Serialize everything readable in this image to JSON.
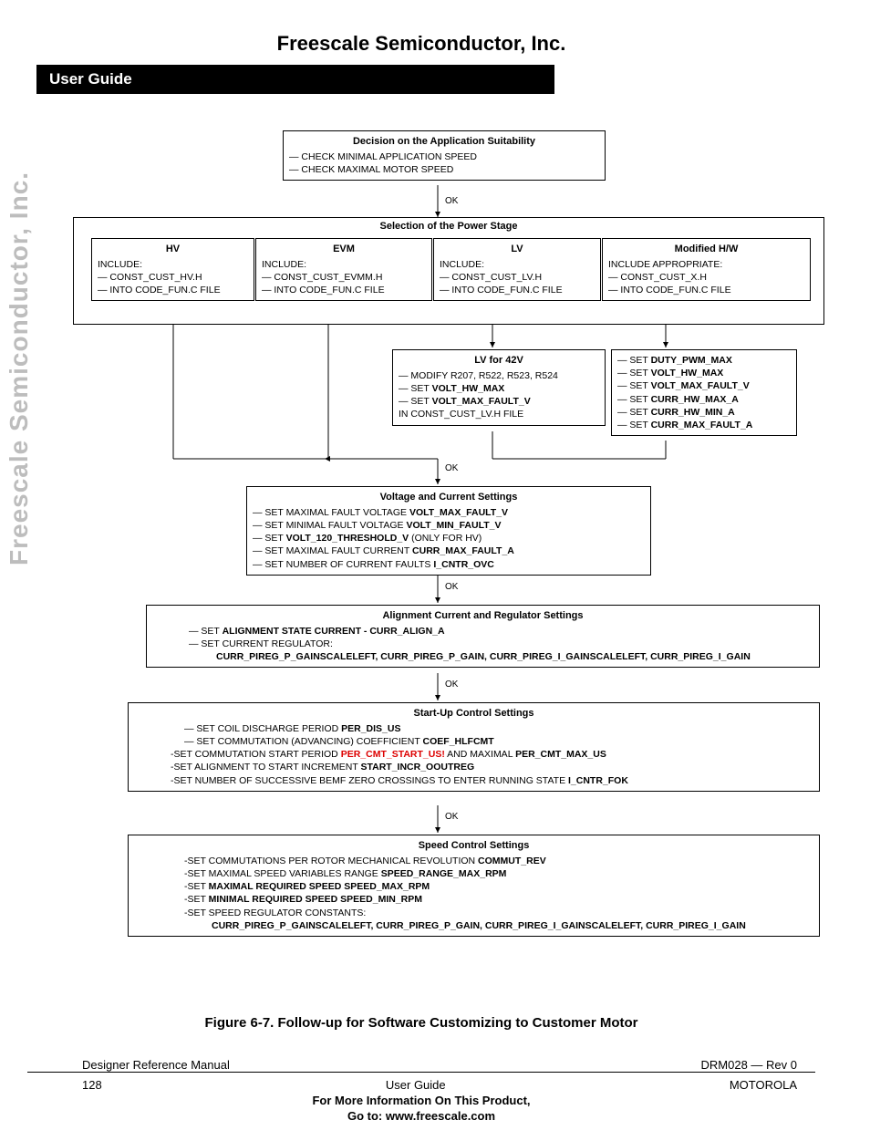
{
  "company": "Freescale Semiconductor, Inc.",
  "header_bar": "User Guide",
  "side_text": "Freescale Semiconductor, Inc.",
  "ok": "OK",
  "decision": {
    "title": "Decision on the Application Suitability",
    "l1": "— CHECK MINIMAL APPLICATION SPEED",
    "l2": "— CHECK MAXIMAL MOTOR SPEED"
  },
  "selection_title": "Selection of the Power Stage",
  "hv": {
    "title": "HV",
    "inc": "INCLUDE:",
    "l1": "— CONST_CUST_HV.H",
    "l2": "— INTO CODE_FUN.C FILE"
  },
  "evm": {
    "title": "EVM",
    "inc": "INCLUDE:",
    "l1": "— CONST_CUST_EVMM.H",
    "l2": "— INTO CODE_FUN.C FILE"
  },
  "lv": {
    "title": "LV",
    "inc": "INCLUDE:",
    "l1": "— CONST_CUST_LV.H",
    "l2": "— INTO CODE_FUN.C FILE"
  },
  "mod": {
    "title": "Modified H/W",
    "inc": "INCLUDE APPROPRIATE:",
    "l1": "— CONST_CUST_X.H",
    "l2": "— INTO CODE_FUN.C FILE"
  },
  "lv42": {
    "title": "LV for 42V",
    "l1": "— MODIFY R207, R522, R523, R524",
    "l2a": "— SET ",
    "l2b": "VOLT_HW_MAX",
    "l3a": "— SET ",
    "l3b": "VOLT_MAX_FAULT_V",
    "l4": "IN CONST_CUST_LV.H FILE"
  },
  "modset": {
    "l1a": "— SET ",
    "l1b": "DUTY_PWM_MAX",
    "l2a": "— SET ",
    "l2b": "VOLT_HW_MAX",
    "l3a": "— SET ",
    "l3b": "VOLT_MAX_FAULT_V",
    "l4a": "— SET ",
    "l4b": "CURR_HW_MAX_A",
    "l5a": "— SET ",
    "l5b": "CURR_HW_MIN_A",
    "l6a": "— SET ",
    "l6b": "CURR_MAX_FAULT_A"
  },
  "vcs": {
    "title": "Voltage and Current Settings",
    "l1a": "— SET MAXIMAL FAULT VOLTAGE ",
    "l1b": "VOLT_MAX_FAULT_V",
    "l2a": "— SET MINIMAL FAULT VOLTAGE ",
    "l2b": "VOLT_MIN_FAULT_V",
    "l3a": "— SET ",
    "l3b": "VOLT_120_THRESHOLD_V",
    "l3c": " (ONLY FOR HV)",
    "l4a": "— SET MAXIMAL FAULT CURRENT ",
    "l4b": "CURR_MAX_FAULT_A",
    "l5a": "— SET NUMBER OF CURRENT FAULTS ",
    "l5b": "I_CNTR_OVC"
  },
  "align": {
    "title": "Alignment Current and Regulator Settings",
    "l1a": "— SET ",
    "l1b": "ALIGNMENT STATE CURRENT - CURR_ALIGN_A",
    "l2": "— SET CURRENT REGULATOR:",
    "l3": "CURR_PIREG_P_GAINSCALELEFT, CURR_PIREG_P_GAIN, CURR_PIREG_I_GAINSCALELEFT, CURR_PIREG_I_GAIN"
  },
  "startup": {
    "title": "Start-Up Control Settings",
    "l1a": "— SET COIL DISCHARGE PERIOD ",
    "l1b": "PER_DIS_US",
    "l2a": "— SET COMMUTATION (ADVANCING) COEFFICIENT ",
    "l2b": "COEF_HLFCMT",
    "l3a": "-SET COMMUTATION START PERIOD ",
    "l3b": "PER_CMT_START_US!",
    "l3c": " AND MAXIMAL ",
    "l3d": "PER_CMT_MAX_US",
    "l4a": "-SET ALIGNMENT TO START INCREMENT ",
    "l4b": "START_INCR_OOUTREG",
    "l5a": "-SET NUMBER OF SUCCESSIVE BEMF ZERO CROSSINGS TO ENTER RUNNING STATE ",
    "l5b": "I_CNTR_FOK"
  },
  "speed": {
    "title": "Speed Control Settings",
    "l1a": "-SET COMMUTATIONS PER ROTOR MECHANICAL REVOLUTION ",
    "l1b": "COMMUT_REV",
    "l2a": "-SET MAXIMAL SPEED VARIABLES RANGE ",
    "l2b": "SPEED_RANGE_MAX_RPM",
    "l3a": "-SET ",
    "l3b": "MAXIMAL REQUIRED SPEED SPEED_MAX_RPM",
    "l4a": "-SET ",
    "l4b": "MINIMAL REQUIRED SPEED SPEED_MIN_RPM",
    "l5": "-SET SPEED REGULATOR CONSTANTS:",
    "l6": "CURR_PIREG_P_GAINSCALELEFT, CURR_PIREG_P_GAIN, CURR_PIREG_I_GAINSCALELEFT, CURR_PIREG_I_GAIN"
  },
  "caption": "Figure 6-7. Follow-up for Software Customizing to Customer Motor",
  "footer": {
    "left1": "Designer Reference Manual",
    "right1": "DRM028 — Rev 0",
    "left2": "128",
    "mid2": "User Guide",
    "right2": "MOTOROLA",
    "info1": "For More Information On This Product,",
    "info2": "Go to: www.freescale.com"
  }
}
